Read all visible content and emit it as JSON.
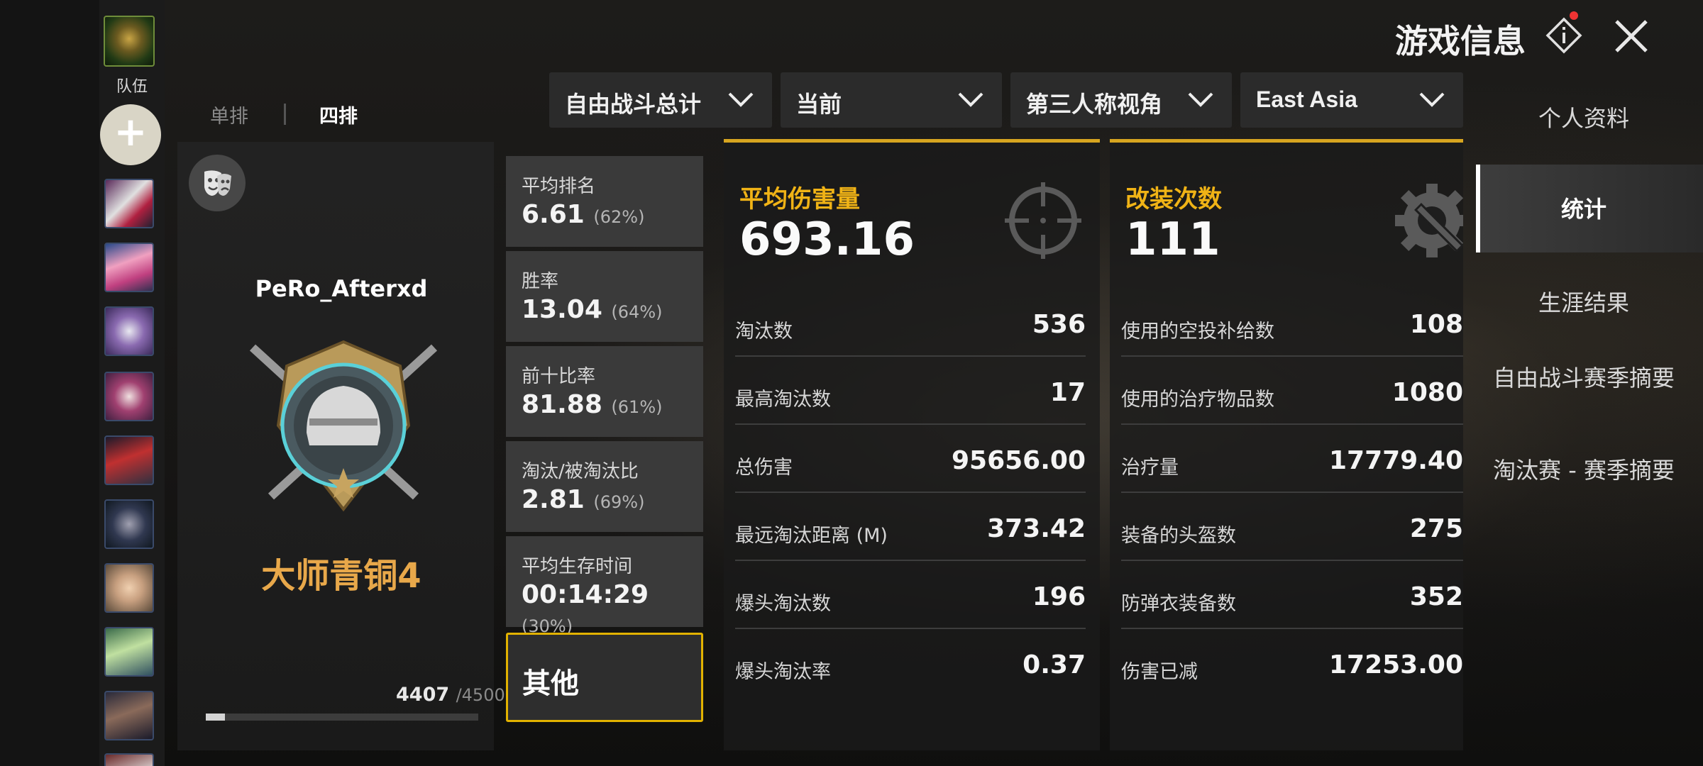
{
  "header": {
    "title": "游戏信息"
  },
  "sidebar_team": {
    "label": "队伍",
    "add_label": "+"
  },
  "right_nav": {
    "items": [
      {
        "label": "个人资料"
      },
      {
        "label": "统计"
      },
      {
        "label": "生涯结果"
      },
      {
        "label": "自由战斗赛季摘要"
      },
      {
        "label": "淘汰赛 - 赛季摘要"
      }
    ],
    "active_index": 1
  },
  "mode_tabs": [
    {
      "label": "单排"
    },
    {
      "label": "四排"
    }
  ],
  "filters": [
    {
      "label": "自由战斗总计"
    },
    {
      "label": "当前"
    },
    {
      "label": "第三人称视角"
    },
    {
      "label": "East Asia"
    }
  ],
  "player": {
    "name": "PeRo_Afterxd",
    "rank": "大师青铜4",
    "rp_current": "4407",
    "rp_max": "/4500",
    "rp_fraction": 0.07
  },
  "stats": [
    {
      "label": "平均排名",
      "value": "6.61",
      "pct": "(62%)"
    },
    {
      "label": "胜率",
      "value": "13.04",
      "pct": "(64%)"
    },
    {
      "label": "前十比率",
      "value": "81.88",
      "pct": "(61%)"
    },
    {
      "label": "淘汰/被淘汰比",
      "value": "2.81",
      "pct": "(69%)"
    },
    {
      "label": "平均生存时间",
      "value": "00:14:29",
      "pct": "(30%)"
    }
  ],
  "other_label": "其他",
  "combat_panel": {
    "title": "平均伤害量",
    "value": "693.16",
    "rows": [
      {
        "label": "淘汰数",
        "value": "536"
      },
      {
        "label": "最高淘汰数",
        "value": "17"
      },
      {
        "label": "总伤害",
        "value": "95656.00"
      },
      {
        "label": "最远淘汰距离 (M)",
        "value": "373.42"
      },
      {
        "label": "爆头淘汰数",
        "value": "196"
      },
      {
        "label": "爆头淘汰率",
        "value": "0.37"
      }
    ]
  },
  "support_panel": {
    "title": "改装次数",
    "value": "111",
    "rows": [
      {
        "label": "使用的空投补给数",
        "value": "108"
      },
      {
        "label": "使用的治疗物品数",
        "value": "1080"
      },
      {
        "label": "治疗量",
        "value": "17779.40"
      },
      {
        "label": "装备的头盔数",
        "value": "275"
      },
      {
        "label": "防弹衣装备数",
        "value": "352"
      },
      {
        "label": "伤害已减",
        "value": "17253.00"
      }
    ]
  },
  "colors": {
    "accent": "#f0b316",
    "rank": "#e8a84a",
    "selected_border": "#e2b200"
  },
  "icons": {
    "crosshair": "crosshair-icon",
    "gear_wrench": "gear-wrench-icon",
    "mask": "theater-mask-icon",
    "info": "info-diamond-icon",
    "close": "close-icon"
  }
}
